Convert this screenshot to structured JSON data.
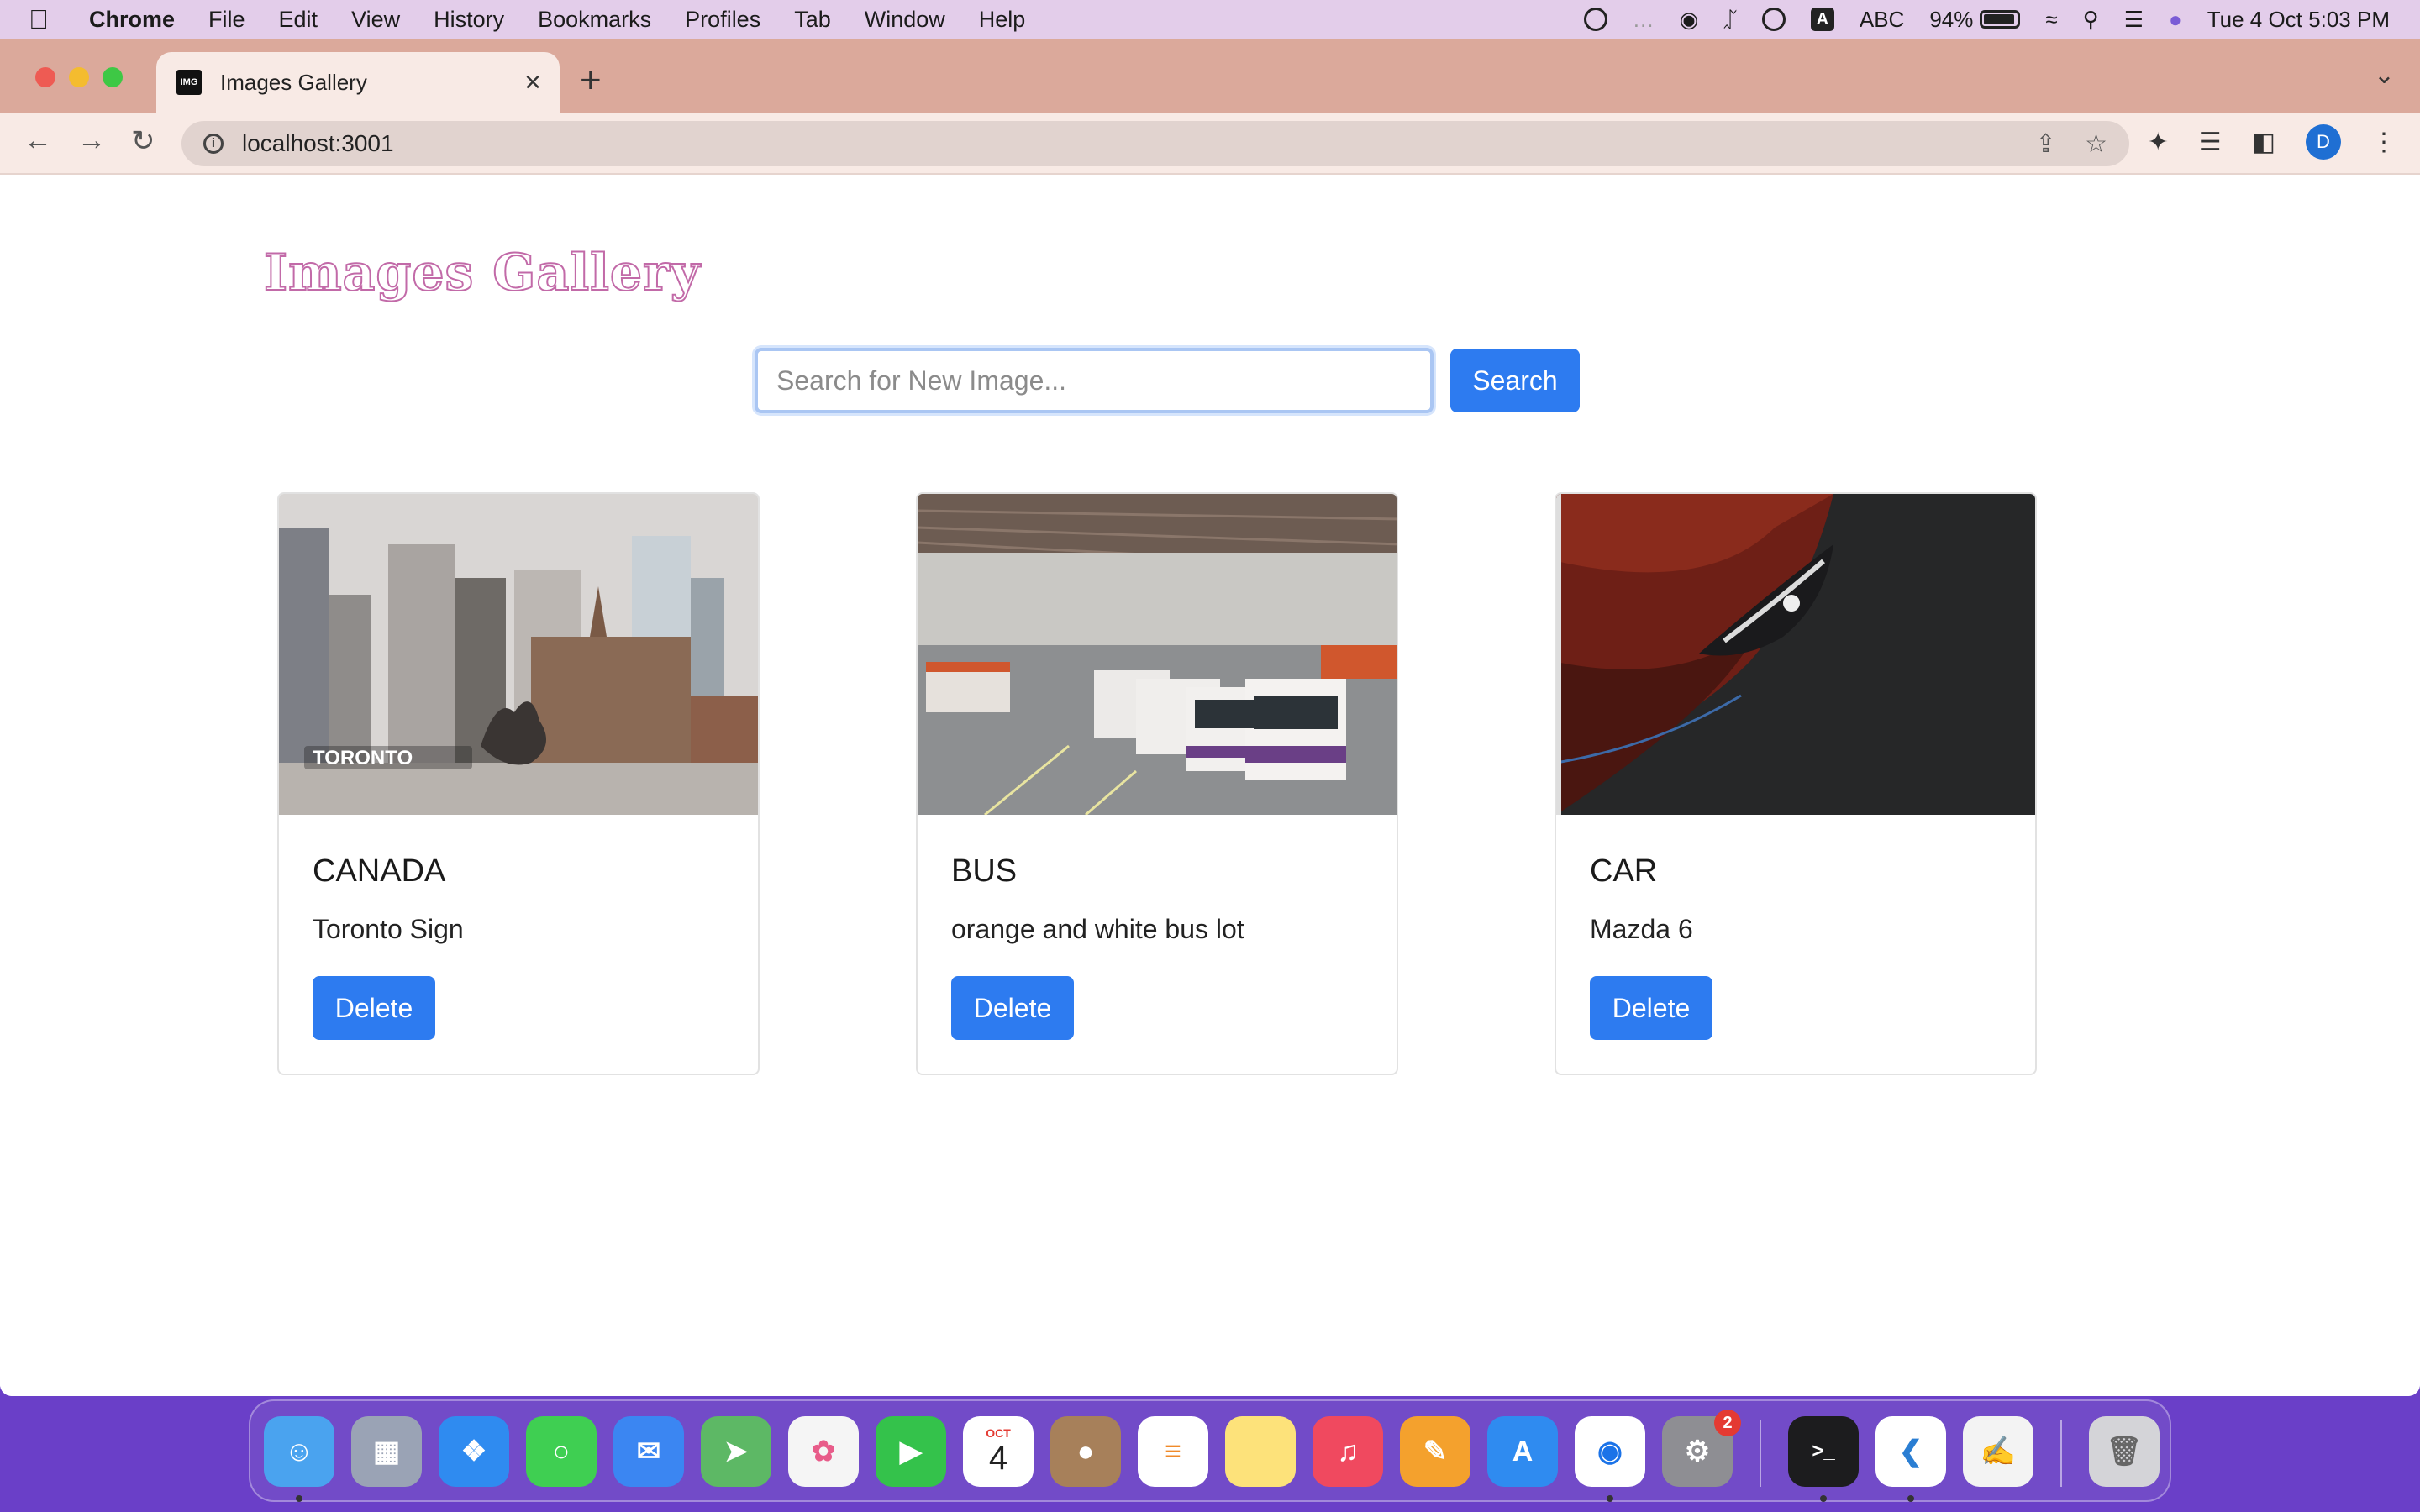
{
  "menubar": {
    "app_name": "Chrome",
    "items": [
      "File",
      "Edit",
      "View",
      "History",
      "Bookmarks",
      "Profiles",
      "Tab",
      "Window",
      "Help"
    ],
    "input_source": "ABC",
    "battery": "94%",
    "battery_level": 0.94,
    "datetime": "Tue 4 Oct  5:03 PM"
  },
  "browser": {
    "tab_title": "Images Gallery",
    "favicon_text": "IMG",
    "url": "localhost:3001",
    "profile_initial": "D"
  },
  "page": {
    "logo": "Images Gallery",
    "search": {
      "placeholder": "Search for New Image...",
      "value": "",
      "button_label": "Search"
    },
    "cards": [
      {
        "title": "CANADA",
        "description": "Toronto Sign",
        "button_label": "Delete",
        "image_overlay_text": "TORONTO"
      },
      {
        "title": "BUS",
        "description": "orange and white bus lot",
        "button_label": "Delete"
      },
      {
        "title": "CAR",
        "description": "Mazda 6",
        "button_label": "Delete"
      }
    ]
  },
  "dock": {
    "calendar_month": "OCT",
    "calendar_day": "4",
    "system_settings_badge": "2"
  },
  "colors": {
    "primary_button": "#2d7bf0",
    "logo_outline": "#c26aa8",
    "tabstrip": "#dba99b",
    "menubar": "#e3cdea",
    "desktop": "#6a3fc8"
  }
}
